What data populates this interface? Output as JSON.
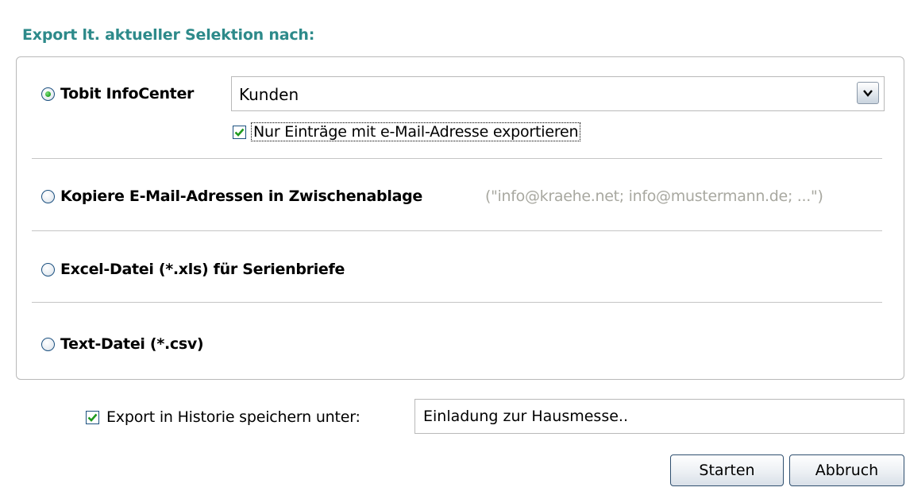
{
  "heading": "Export lt. aktueller Selektion nach:",
  "options": [
    {
      "label": "Tobit InfoCenter",
      "selected": true
    },
    {
      "label": "Kopiere E-Mail-Adressen in Zwischenablage",
      "selected": false
    },
    {
      "label": "Excel-Datei (*.xls) für Serienbriefe",
      "selected": false
    },
    {
      "label": "Text-Datei (*.csv)",
      "selected": false
    }
  ],
  "infocenter": {
    "select_value": "Kunden",
    "only_email_label": "Nur Einträge mit e-Mail-Adresse exportieren",
    "only_email_checked": true
  },
  "clipboard_hint": "(\"info@kraehe.net; info@mustermann.de; ...\")",
  "history": {
    "checkbox_label": "Export in Historie speichern unter:",
    "checked": true,
    "value": "Einladung zur Hausmesse.."
  },
  "buttons": {
    "start": "Starten",
    "cancel": "Abbruch"
  },
  "colors": {
    "heading": "#2d8a8a",
    "hint": "#a8a8a0",
    "check": "#1f9a1f",
    "border": "#1c5180"
  }
}
